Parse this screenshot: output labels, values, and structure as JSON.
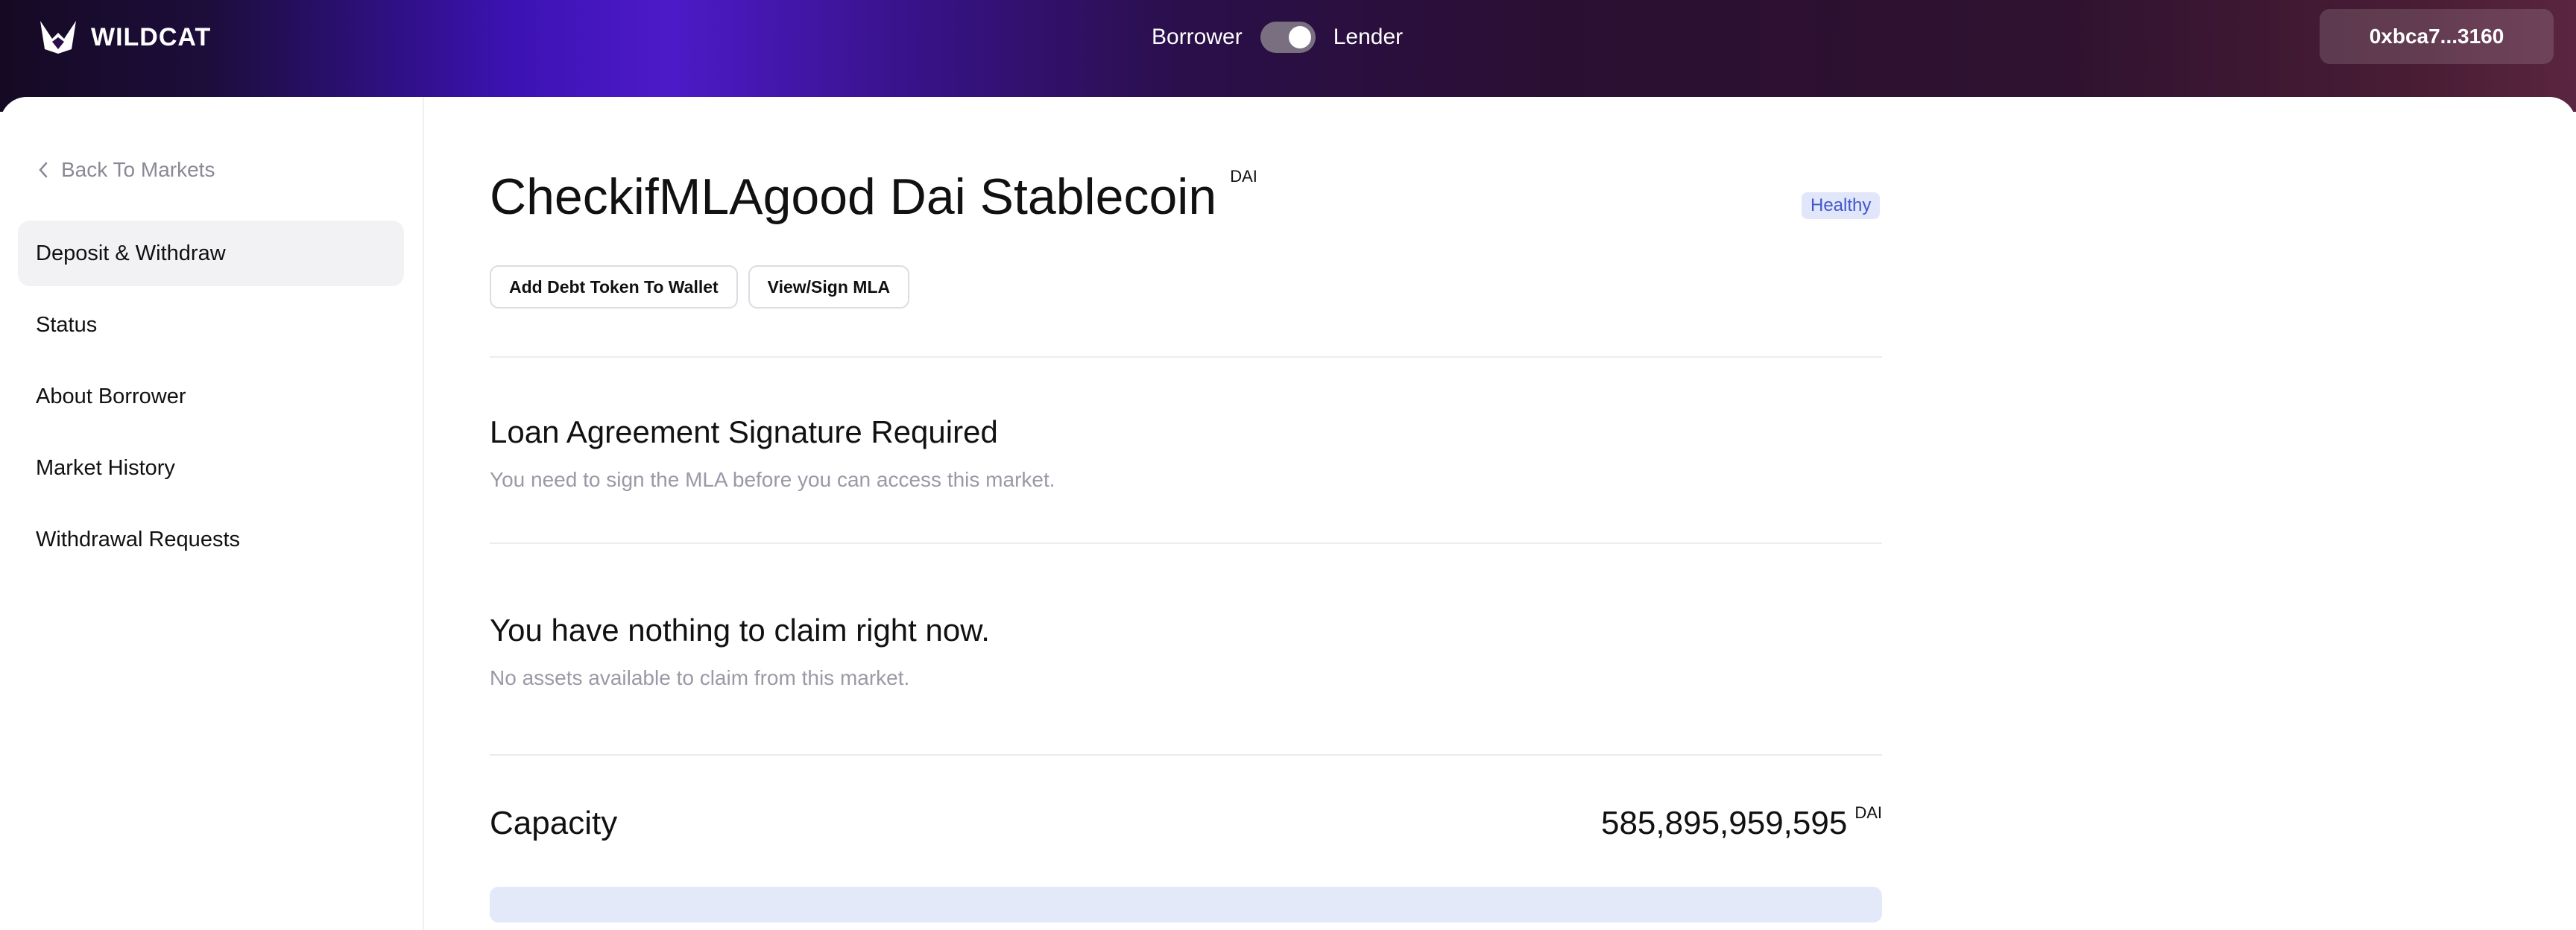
{
  "header": {
    "brand": "WILDCAT",
    "role_left": "Borrower",
    "role_right": "Lender",
    "wallet": "0xbca7...3160"
  },
  "sidebar": {
    "back_label": "Back To Markets",
    "items": [
      {
        "label": "Deposit & Withdraw",
        "active": true
      },
      {
        "label": "Status"
      },
      {
        "label": "About Borrower"
      },
      {
        "label": "Market History"
      },
      {
        "label": "Withdrawal Requests"
      }
    ]
  },
  "market": {
    "title": "CheckifMLAgood Dai Stablecoin",
    "asset": "DAI",
    "status": "Healthy",
    "buttons": {
      "add_token": "Add Debt Token To Wallet",
      "view_mla": "View/Sign MLA"
    }
  },
  "sections": {
    "mla": {
      "title": "Loan Agreement Signature Required",
      "subtitle": "You need to sign the MLA before you can access this market."
    },
    "claim": {
      "title": "You have nothing to claim right now.",
      "subtitle": "No assets available to claim from this market."
    },
    "capacity": {
      "label": "Capacity",
      "value": "585,895,959,595",
      "asset": "DAI",
      "utilization_fraction": 0
    }
  },
  "colors": {
    "accent": "#4157c9",
    "badge_bg": "#e1e6fb",
    "progress_track": "#e4e9fa"
  },
  "icons": {
    "logo": "wildcat-logo-icon",
    "back": "chevron-left-icon"
  }
}
